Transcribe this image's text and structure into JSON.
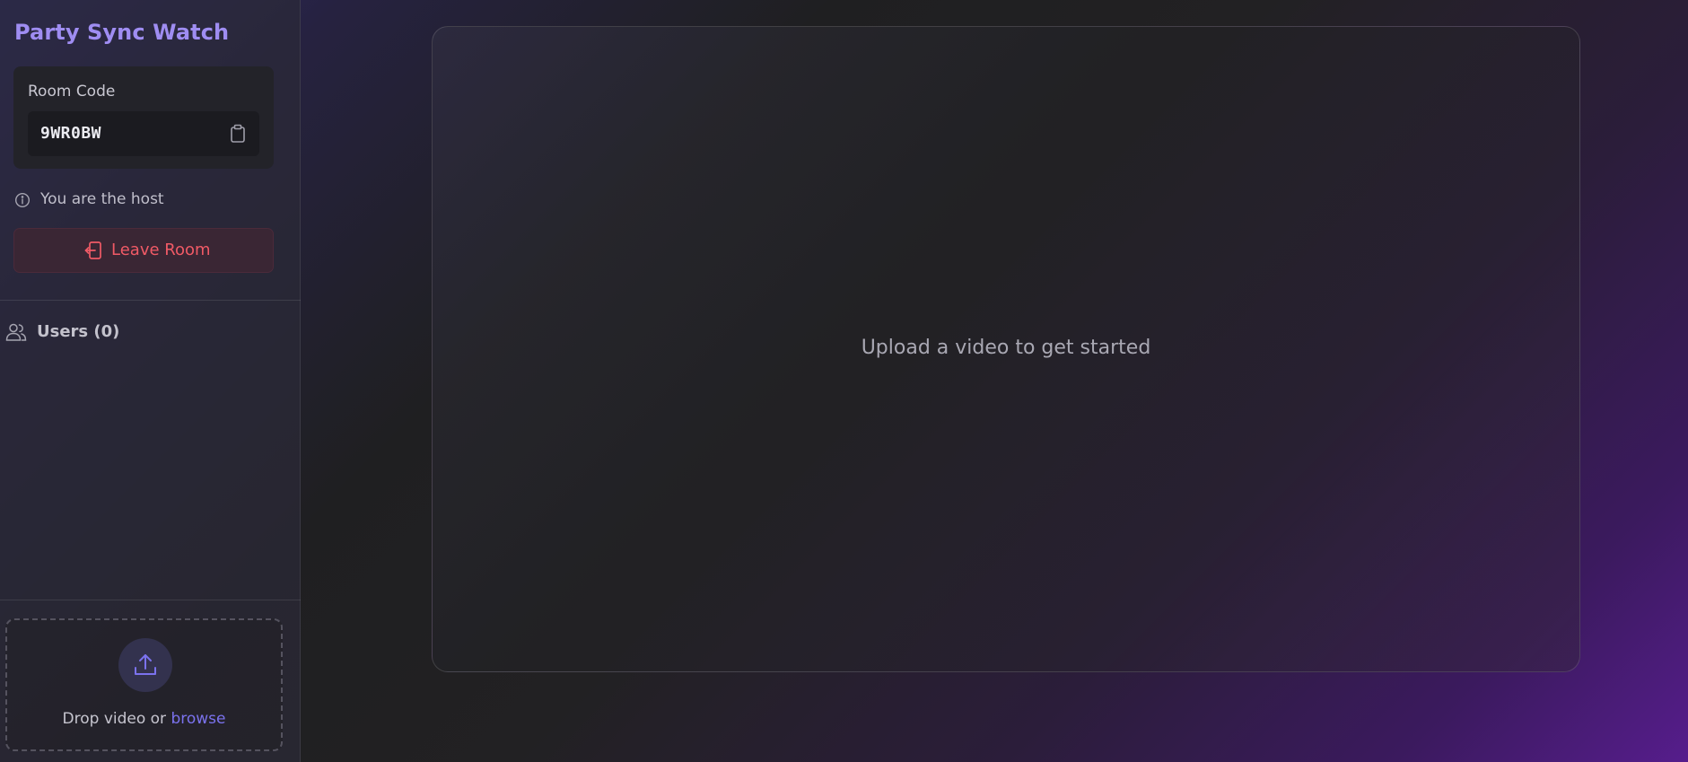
{
  "app": {
    "title": "Party Sync Watch"
  },
  "room": {
    "label": "Room Code",
    "code": "9WR0BW",
    "copy_icon": "clipboard-icon"
  },
  "status": {
    "host_text": "You are the host",
    "icon": "info-icon"
  },
  "leave": {
    "label": "Leave Room",
    "icon": "logout-icon",
    "color": "#f05a66"
  },
  "users": {
    "label": "Users (0)",
    "icon": "users-icon",
    "items": []
  },
  "dropzone": {
    "prefix": "Drop video or ",
    "link": "browse",
    "icon": "upload-icon"
  },
  "player": {
    "message": "Upload a video to get started"
  },
  "colors": {
    "accent": "#9f8df2",
    "link": "#7b72ee",
    "danger": "#f05a66"
  }
}
